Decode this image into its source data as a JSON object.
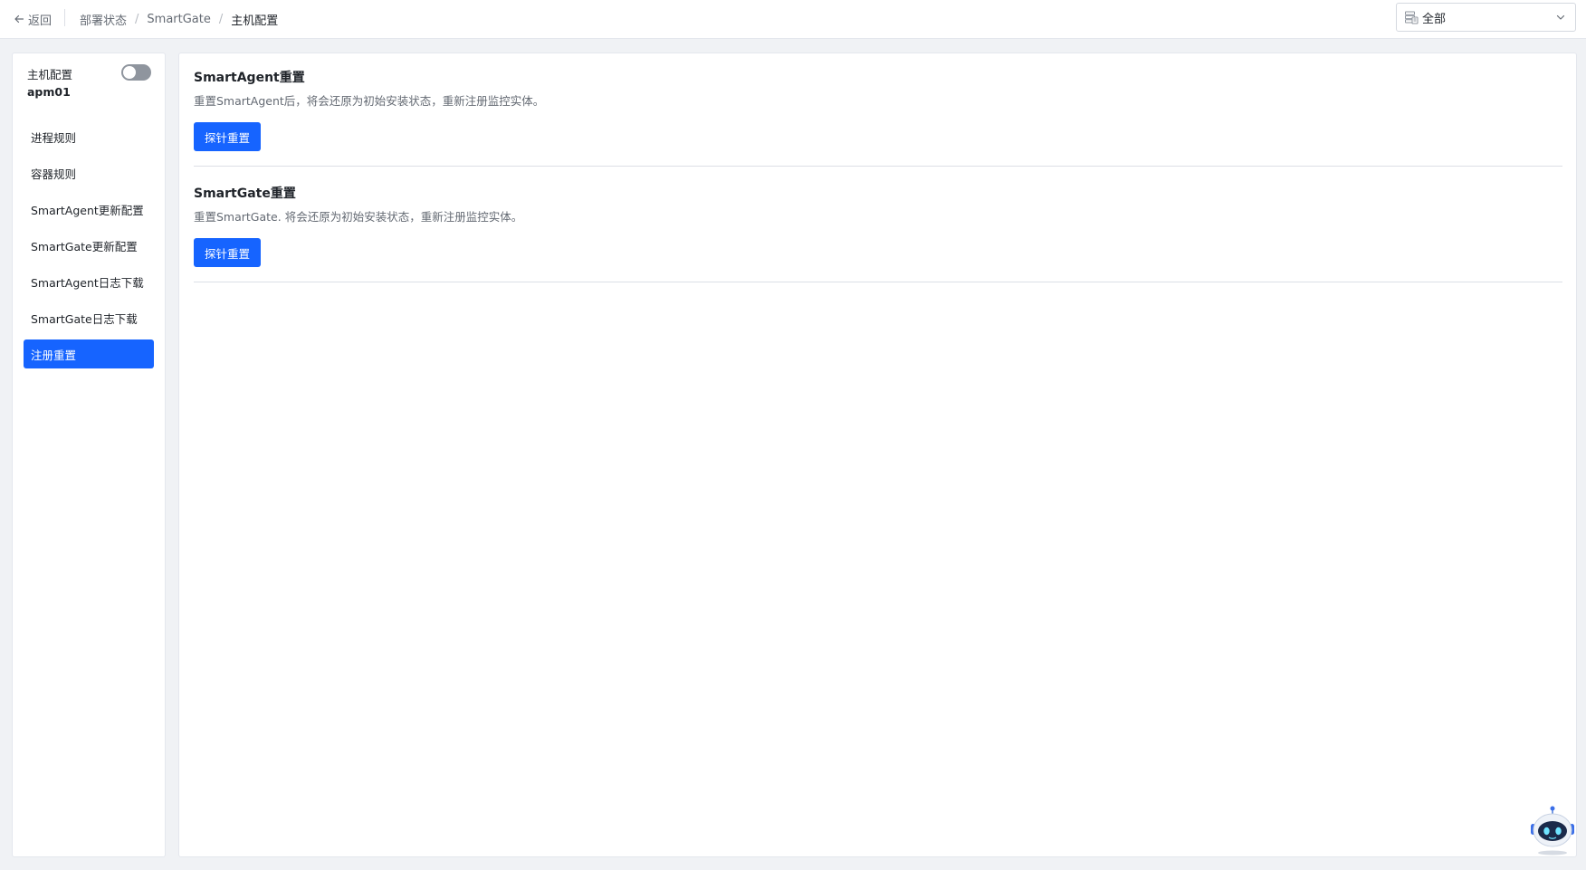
{
  "topbar": {
    "back_label": "返回",
    "breadcrumb": [
      "部署状态",
      "SmartGate",
      "主机配置"
    ],
    "breadcrumb_sep": "/",
    "scope_select": {
      "value": "全部",
      "icon": "server-list-icon"
    }
  },
  "sidebar": {
    "header_label": "主机配置",
    "toggle_on": false,
    "host_name": "apm01",
    "items": [
      {
        "label": "进程规则",
        "active": false
      },
      {
        "label": "容器规则",
        "active": false
      },
      {
        "label": "SmartAgent更新配置",
        "active": false
      },
      {
        "label": "SmartGate更新配置",
        "active": false
      },
      {
        "label": "SmartAgent日志下载",
        "active": false
      },
      {
        "label": "SmartGate日志下载",
        "active": false
      },
      {
        "label": "注册重置",
        "active": true
      }
    ]
  },
  "main": {
    "sections": [
      {
        "title": "SmartAgent重置",
        "description": "重置SmartAgent后，将会还原为初始安装状态，重新注册监控实体。",
        "button_label": "探针重置"
      },
      {
        "title": "SmartGate重置",
        "description": "重置SmartGate. 将会还原为初始安装状态，重新注册监控实体。",
        "button_label": "探针重置"
      }
    ]
  },
  "colors": {
    "accent": "#1664ff",
    "background": "#f0f2f5",
    "text_primary": "#1f2329",
    "text_secondary": "#646a73",
    "toggle_off": "#8f959e"
  },
  "assistant": {
    "icon": "robot-assistant-icon"
  }
}
